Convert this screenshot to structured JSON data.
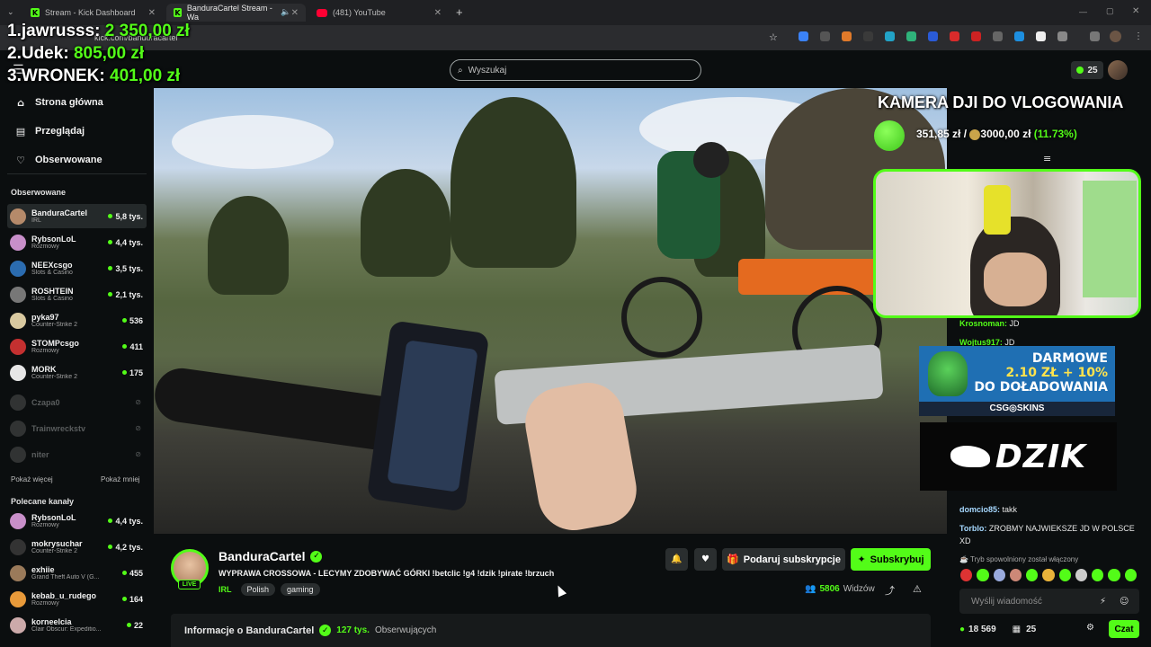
{
  "browser": {
    "tabs": [
      {
        "label": "Stream - Kick Dashboard"
      },
      {
        "label": "BanduraCartel Stream - Wa"
      },
      {
        "label": "(481) YouTube"
      }
    ],
    "url": "kick.com/banduracartel",
    "new_tab": "+"
  },
  "overlay": {
    "ranking": [
      {
        "place": "1.",
        "name": "jawrusss:",
        "amount": "2 350,00 zł"
      },
      {
        "place": "2.",
        "name": "Udek:",
        "amount": "805,00 zł"
      },
      {
        "place": "3.",
        "name": "WRONEK:",
        "amount": "401,00 zł"
      }
    ],
    "camera_title": "KAMERA DJI DO VLOGOWANIA",
    "goal": {
      "current": "351,85 zł",
      "separator": "/",
      "target": "3000,00 zł",
      "percent": "(11.73%)",
      "progress": 0.1173
    },
    "ad1": {
      "line1": "DARMOWE",
      "line2": "2.10 ZŁ + 10%",
      "line3": "DO DOŁADOWANIA",
      "brand": "CSG◎SKINS"
    },
    "ad2": {
      "brand": "DZIK"
    }
  },
  "header": {
    "search_placeholder": "Wyszukaj",
    "kicks_count": "25"
  },
  "sidebar": {
    "nav": [
      {
        "label": "Strona główna",
        "icon": "home-icon",
        "glyph": "⌂"
      },
      {
        "label": "Przeglądaj",
        "icon": "browse-icon",
        "glyph": "▤"
      },
      {
        "label": "Obserwowane",
        "icon": "heart-icon",
        "glyph": "♡"
      }
    ],
    "followed_title": "Obserwowane",
    "followed": [
      {
        "name": "BanduraCartel",
        "category": "IRL",
        "viewers": "5,8 tys.",
        "color": "#b58a6a"
      },
      {
        "name": "RybsonLoL",
        "category": "Rozmowy",
        "viewers": "4,4 tys.",
        "color": "#c88fc9"
      },
      {
        "name": "NEEXcsgo",
        "category": "Slots & Casino",
        "viewers": "3,5 tys.",
        "color": "#2b6cb0"
      },
      {
        "name": "ROSHTEIN",
        "category": "Slots & Casino",
        "viewers": "2,1 tys.",
        "color": "#777"
      },
      {
        "name": "pyka97",
        "category": "Counter-Strike 2",
        "viewers": "536",
        "color": "#d9c9a0"
      },
      {
        "name": "STOMPcsgo",
        "category": "Rozmowy",
        "viewers": "411",
        "color": "#c43030"
      },
      {
        "name": "MORK",
        "category": "Counter-Strike 2",
        "viewers": "175",
        "color": "#e6e6e6"
      }
    ],
    "offline": [
      {
        "name": "Czapa0"
      },
      {
        "name": "Trainwreckstv"
      },
      {
        "name": "niter"
      }
    ],
    "show_more": "Pokaż więcej",
    "show_less": "Pokaż mniej",
    "recommended_title": "Polecane kanały",
    "recommended": [
      {
        "name": "RybsonLoL",
        "category": "Rozmowy",
        "viewers": "4,4 tys.",
        "color": "#c88fc9"
      },
      {
        "name": "mokrysuchar",
        "category": "Counter-Strike 2",
        "viewers": "4,2 tys.",
        "color": "#333"
      },
      {
        "name": "exhiie",
        "category": "Grand Theft Auto V (G...",
        "viewers": "455",
        "color": "#9a7a5a"
      },
      {
        "name": "kebab_u_rudego",
        "category": "Rozmowy",
        "viewers": "164",
        "color": "#e89a3a"
      },
      {
        "name": "korneelcia",
        "category": "Clair Obscur: Expeditio...",
        "viewers": "22",
        "color": "#caa"
      }
    ]
  },
  "chat": {
    "messages": [
      {
        "user": "Krosnoman:",
        "text": "JD",
        "color": "g"
      },
      {
        "user": "Wojtus917:",
        "text": "JD",
        "color": "g"
      },
      {
        "user": "domcio85:",
        "text": "takk",
        "color": "b"
      },
      {
        "user": "Torblo:",
        "text": "ZROBMY NAJWIEKSZE JD W POLSCE XD",
        "color": "b"
      }
    ],
    "slow_mode": "Tryb spowolniony został włączony",
    "input_placeholder": "Wyślij wiadomość",
    "points": "18 569",
    "kicks": "25",
    "chat_button": "Czat"
  },
  "stream": {
    "channel": "BanduraCartel",
    "title": "WYPRAWA CROSSOWA - LECYMY ZDOBYWAĆ GÓRKI !betclic !g4 !dzik !pirate !brzuch",
    "category": "IRL",
    "tags": [
      "Polish",
      "gaming"
    ],
    "live_label": "LIVE",
    "gift_button": "Podaruj subskrypcje",
    "subscribe_button": "Subskrybuj",
    "viewers_count": "5806",
    "viewers_label": "Widzów",
    "about_prefix": "Informacje o BanduraCartel",
    "followers_count": "127 tys.",
    "followers_label": "Obserwujących"
  }
}
